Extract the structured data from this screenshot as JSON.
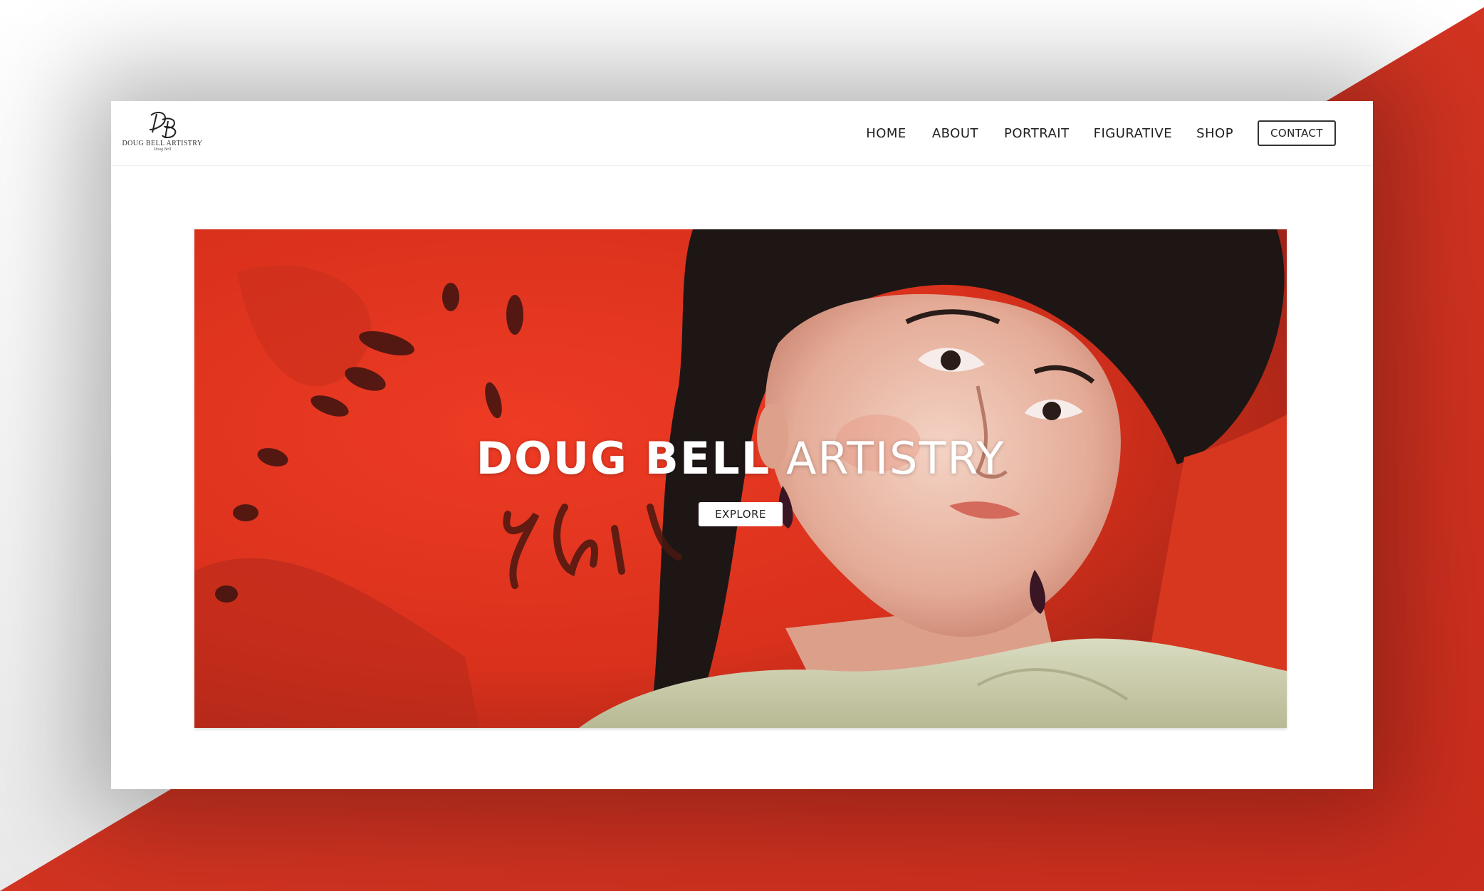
{
  "site": {
    "logo": {
      "monogram": "DB",
      "name": "DOUG BELL ARTISTRY",
      "signature": "Doug Bell"
    }
  },
  "nav": {
    "items": [
      {
        "label": "HOME"
      },
      {
        "label": "ABOUT"
      },
      {
        "label": "PORTRAIT"
      },
      {
        "label": "FIGURATIVE"
      },
      {
        "label": "SHOP"
      }
    ],
    "contact_label": "CONTACT"
  },
  "hero": {
    "title_bold": "DOUG BELL",
    "title_light": "ARTISTRY",
    "button_label": "EXPLORE",
    "image_icon": "portrait-painting-image"
  },
  "colors": {
    "accent_red": "#d33422",
    "text_dark": "#1f1f1f",
    "white": "#ffffff"
  }
}
